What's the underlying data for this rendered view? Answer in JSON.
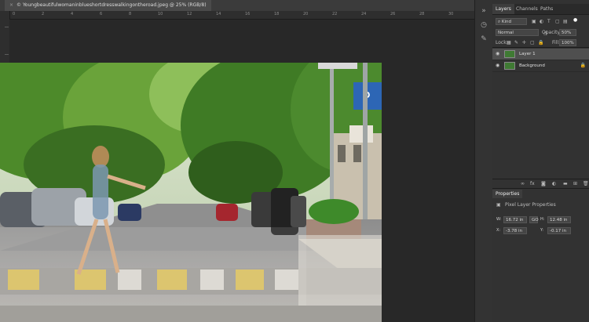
{
  "document_tab": {
    "close": "×",
    "title": "© Youngbeautifulwomaninblueshortdresswalkingontheroad.jpeg @ 25% (RGB/8)"
  },
  "ruler": {
    "labels": [
      "0",
      "2",
      "4",
      "6",
      "8",
      "10",
      "12",
      "14",
      "16",
      "18",
      "20",
      "22",
      "24",
      "26",
      "28",
      "30"
    ]
  },
  "layers_panel": {
    "tabs": [
      "Layers",
      "Channels",
      "Paths"
    ],
    "active_tab": "Layers",
    "filter_kind": "Kind",
    "blend_mode": "Normal",
    "opacity_label": "Opacity:",
    "opacity_value": "50%",
    "lock_label": "Lock:",
    "fill_label": "Fill:",
    "fill_value": "100%",
    "layers": [
      {
        "name": "Layer 1",
        "selected": true
      },
      {
        "name": "Background",
        "selected": false,
        "locked": true
      }
    ]
  },
  "properties_panel": {
    "tab": "Properties",
    "subtitle": "Pixel Layer Properties",
    "w_label": "W:",
    "w_value": "16.72 in",
    "link_label": "GO",
    "h_label": "H:",
    "h_value": "12.48 in",
    "x_label": "X:",
    "x_value": "-3.78 in",
    "y_label": "Y:",
    "y_value": "-0.17 in"
  },
  "colors": {
    "panel_bg": "#323232",
    "canvas_bg": "#282828",
    "selected_layer": "#4f4f4f"
  }
}
